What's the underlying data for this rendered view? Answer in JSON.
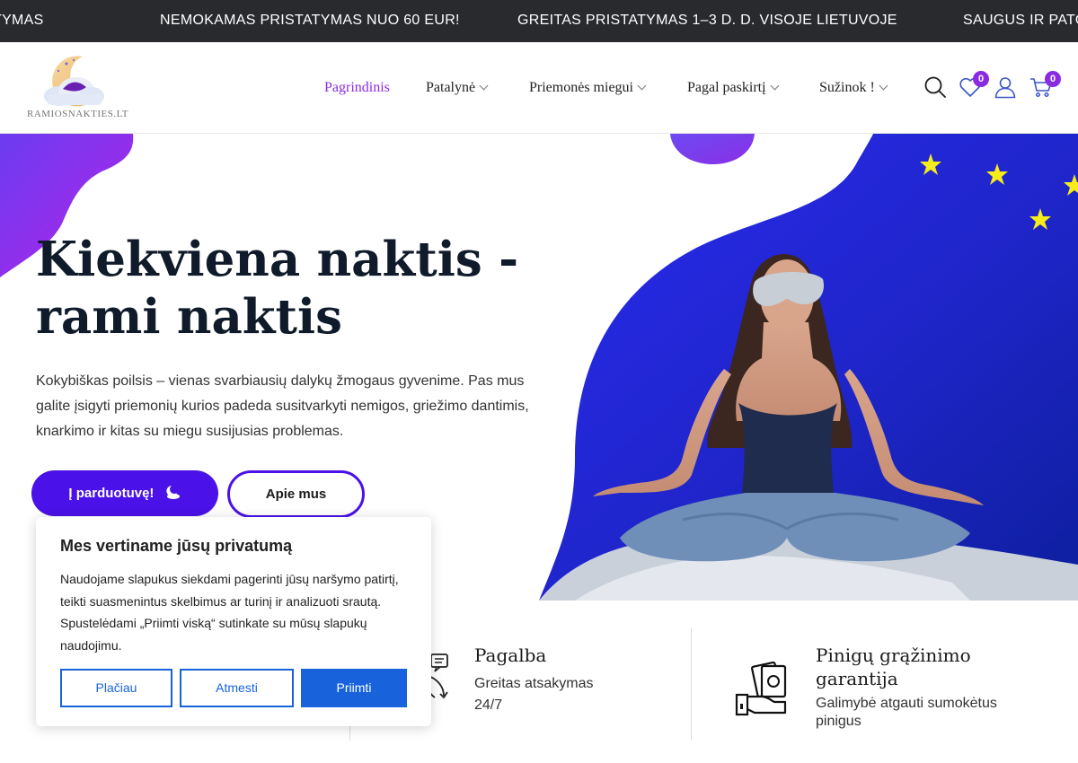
{
  "announcements": [
    "TYMAS",
    "NEMOKAMAS PRISTATYMAS NUO 60 EUR!",
    "GREITAS PRISTATYMAS 1–3 D. D. VISOJE LIETUVOJE",
    "SAUGUS IR PATO"
  ],
  "header": {
    "logo_text": "RAMIOSNAKTIES.LT",
    "nav": [
      {
        "label": "Pagrindinis",
        "active": true,
        "dropdown": false
      },
      {
        "label": "Patalynė",
        "active": false,
        "dropdown": true
      },
      {
        "label": "Priemonės miegui",
        "active": false,
        "dropdown": true
      },
      {
        "label": "Pagal paskirtį",
        "active": false,
        "dropdown": true
      },
      {
        "label": "Sužinok !",
        "active": false,
        "dropdown": true
      }
    ],
    "wishlist_count": "0",
    "cart_count": "0",
    "icons": [
      "search-icon",
      "heart-icon",
      "user-icon",
      "cart-icon"
    ]
  },
  "hero": {
    "title_line1": "Kiekviena naktis -",
    "title_line2": "rami naktis",
    "description": "Kokybiškas poilsis – vienas svarbiausių dalykų žmogaus gyvenime. Pas mus galite įsigyti priemonių kurios padeda susitvarkyti nemigos, griežimo dantimis, knarkimo ir kitas su miegu susijusias problemas.",
    "shop_button": "Į parduotuvę!",
    "about_button": "Apie mus"
  },
  "features": [
    {
      "title": "Pagalba",
      "text": "Greitas atsakymas 24/7",
      "icon": "chat-support-icon"
    },
    {
      "title": "Pinigų grąžinimo garantija",
      "text": "Galimybė atgauti sumokėtus pinigus",
      "icon": "money-back-icon"
    }
  ],
  "cookie": {
    "title": "Mes vertiname jūsų privatumą",
    "text": "Naudojame slapukus siekdami pagerinti jūsų naršymo patirtį, teikti suasmenintus skelbimus ar turinį ir analizuoti srautą. Spustelėdami „Priimti viską“ sutinkate su mūsų slapukų naudojimu.",
    "more_label": "Plačiau",
    "reject_label": "Atmesti",
    "accept_label": "Priimti"
  },
  "colors": {
    "accent": "#4a12e8",
    "nav_active": "#8a2be2",
    "cookie_blue": "#1863dc",
    "topbar": "#282a2e"
  }
}
